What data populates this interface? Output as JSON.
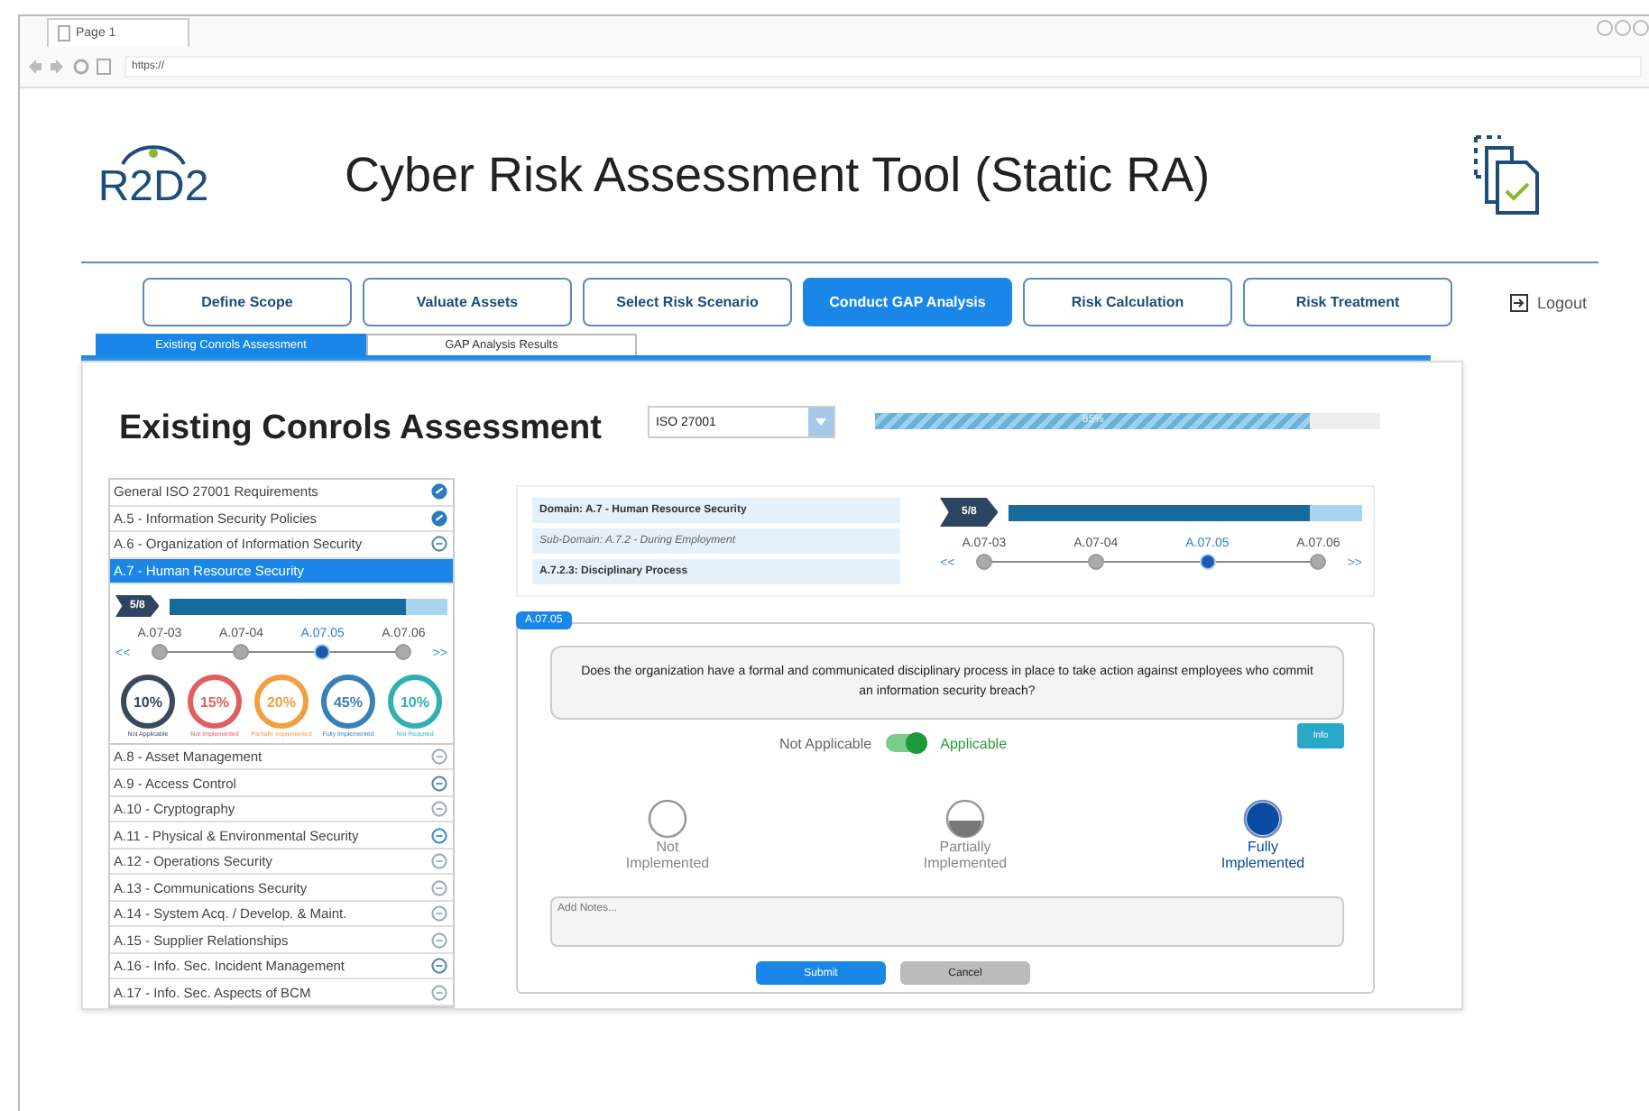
{
  "browser": {
    "tab": "Page 1",
    "address": "https://"
  },
  "header": {
    "logo": "R2D2",
    "title": "Cyber Risk Assessment Tool (Static RA)"
  },
  "steps": [
    {
      "label": "Define Scope",
      "selected": false
    },
    {
      "label": "Valuate Assets",
      "selected": false
    },
    {
      "label": "Select Risk Scenario",
      "selected": false
    },
    {
      "label": "Conduct GAP Analysis",
      "selected": true
    },
    {
      "label": "Risk Calculation",
      "selected": false
    },
    {
      "label": "Risk Treatment",
      "selected": false
    }
  ],
  "logout": "Logout",
  "subtabs": [
    {
      "label": "Existing Conrols Assessment",
      "selected": true
    },
    {
      "label": "GAP Analysis Results",
      "selected": false
    }
  ],
  "page": {
    "heading": "Existing Conrols Assessment",
    "standard": "ISO 27001",
    "progress": {
      "level": 0.86,
      "label": "85%"
    }
  },
  "domains": [
    {
      "label": "General ISO 27001 Requirements",
      "kind": "done",
      "selected": false
    },
    {
      "label": "A.5 - Information Security Policies",
      "kind": "done",
      "selected": false
    },
    {
      "label": "A.6 - Organization of Information Security",
      "kind": "partial",
      "selected": false
    },
    {
      "label": "A.7 - Human Resource Security",
      "selected": true,
      "expanded": true
    },
    {
      "label": "A.8 - Asset Management",
      "kind": "pending",
      "selected": false
    },
    {
      "label": "A.9 - Access Control",
      "kind": "partial",
      "selected": false
    },
    {
      "label": "A.10 - Cryptography",
      "kind": "pending",
      "selected": false
    },
    {
      "label": "A.11 - Physical & Environmental Security",
      "kind": "active",
      "selected": false
    },
    {
      "label": "A.12 - Operations Security",
      "kind": "pending",
      "selected": false
    },
    {
      "label": "A.13 - Communications Security",
      "kind": "pending",
      "selected": false
    },
    {
      "label": "A.14 - System Acq. / Develop. & Maint.",
      "kind": "pending",
      "selected": false
    },
    {
      "label": "A.15 - Supplier Relationships",
      "kind": "pending",
      "selected": false
    },
    {
      "label": "A.16 - Info. Sec. Incident Management",
      "kind": "partial",
      "selected": false
    },
    {
      "label": "A.17 - Info. Sec. Aspects of BCM",
      "kind": "pending",
      "selected": false
    }
  ],
  "domain_detail": {
    "count": "5/8",
    "progress": {
      "level": 0.85
    },
    "prev": "<<",
    "next": ">>",
    "controls": [
      {
        "label": "A.07-03",
        "selected": false
      },
      {
        "label": "A.07-04",
        "selected": false
      },
      {
        "label": "A.07.05",
        "selected": true
      },
      {
        "label": "A.07.06",
        "selected": false
      }
    ],
    "stats": [
      {
        "value": "10%",
        "label": "Not Applicable",
        "color": "#3a4a5c"
      },
      {
        "value": "15%",
        "label": "Not Implemented",
        "color": "#e06060"
      },
      {
        "value": "20%",
        "label": "Partially Implemented",
        "color": "#f0a040"
      },
      {
        "value": "45%",
        "label": "Fully Implemented",
        "color": "#3a80b8"
      },
      {
        "value": "10%",
        "label": "Not Required",
        "color": "#30b0b0"
      }
    ]
  },
  "context": {
    "domain": "Domain: A.7 - Human Resource Security",
    "subdomain": "Sub-Domain: A.7.2 - During Employment",
    "control": "A.7.2.3: Disciplinary Process",
    "count": "5/8",
    "progress": {
      "level": 0.85
    },
    "prev": "<<",
    "next": ">>",
    "controls": [
      {
        "label": "A.07-03",
        "selected": false
      },
      {
        "label": "A.07-04",
        "selected": false
      },
      {
        "label": "A.07.05",
        "selected": true
      },
      {
        "label": "A.07.06",
        "selected": false
      }
    ]
  },
  "question": {
    "tag": "A.07.05",
    "text": "Does the organization have a formal and communicated disciplinary process in place to take action against employees who commit an information security breach?",
    "info": "Info",
    "toggle": {
      "off_label": "Not Applicable",
      "on_label": "Applicable",
      "on": true
    },
    "options": [
      {
        "label": "Not Implemented",
        "kind": "empty",
        "selected": false
      },
      {
        "label": "Partially Implemented",
        "kind": "half",
        "selected": false
      },
      {
        "label": "Fully Implemented",
        "kind": "full",
        "selected": true
      }
    ],
    "notes": {
      "placeholder": "Add Notes..."
    },
    "submit": "Submit",
    "cancel": "Cancel"
  }
}
